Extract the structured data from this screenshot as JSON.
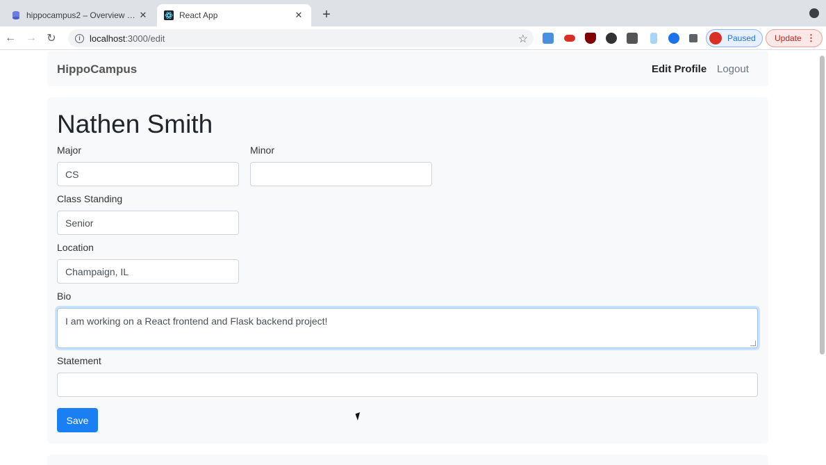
{
  "browser": {
    "tabs": [
      {
        "label": "hippocampus2 – Overview – S",
        "active": false
      },
      {
        "label": "React App",
        "active": true
      }
    ],
    "url_host": "localhost",
    "url_path": ":3000/edit",
    "profile_label": "Paused",
    "update_label": "Update"
  },
  "navbar": {
    "brand": "HippoCampus",
    "links": [
      "Edit Profile",
      "Logout"
    ]
  },
  "profile": {
    "name": "Nathen Smith",
    "fields": {
      "major": {
        "label": "Major",
        "value": "CS"
      },
      "minor": {
        "label": "Minor",
        "value": ""
      },
      "class_standing": {
        "label": "Class Standing",
        "value": "Senior"
      },
      "location": {
        "label": "Location",
        "value": "Champaign, IL"
      },
      "bio": {
        "label": "Bio",
        "value": "I am working on a React frontend and Flask backend project!"
      },
      "statement": {
        "label": "Statement",
        "value": ""
      }
    },
    "save_label": "Save"
  },
  "colors": {
    "primary": "#1a7ff2",
    "navbar_bg": "#f8f9fa",
    "card_bg": "#f8f9fa"
  }
}
